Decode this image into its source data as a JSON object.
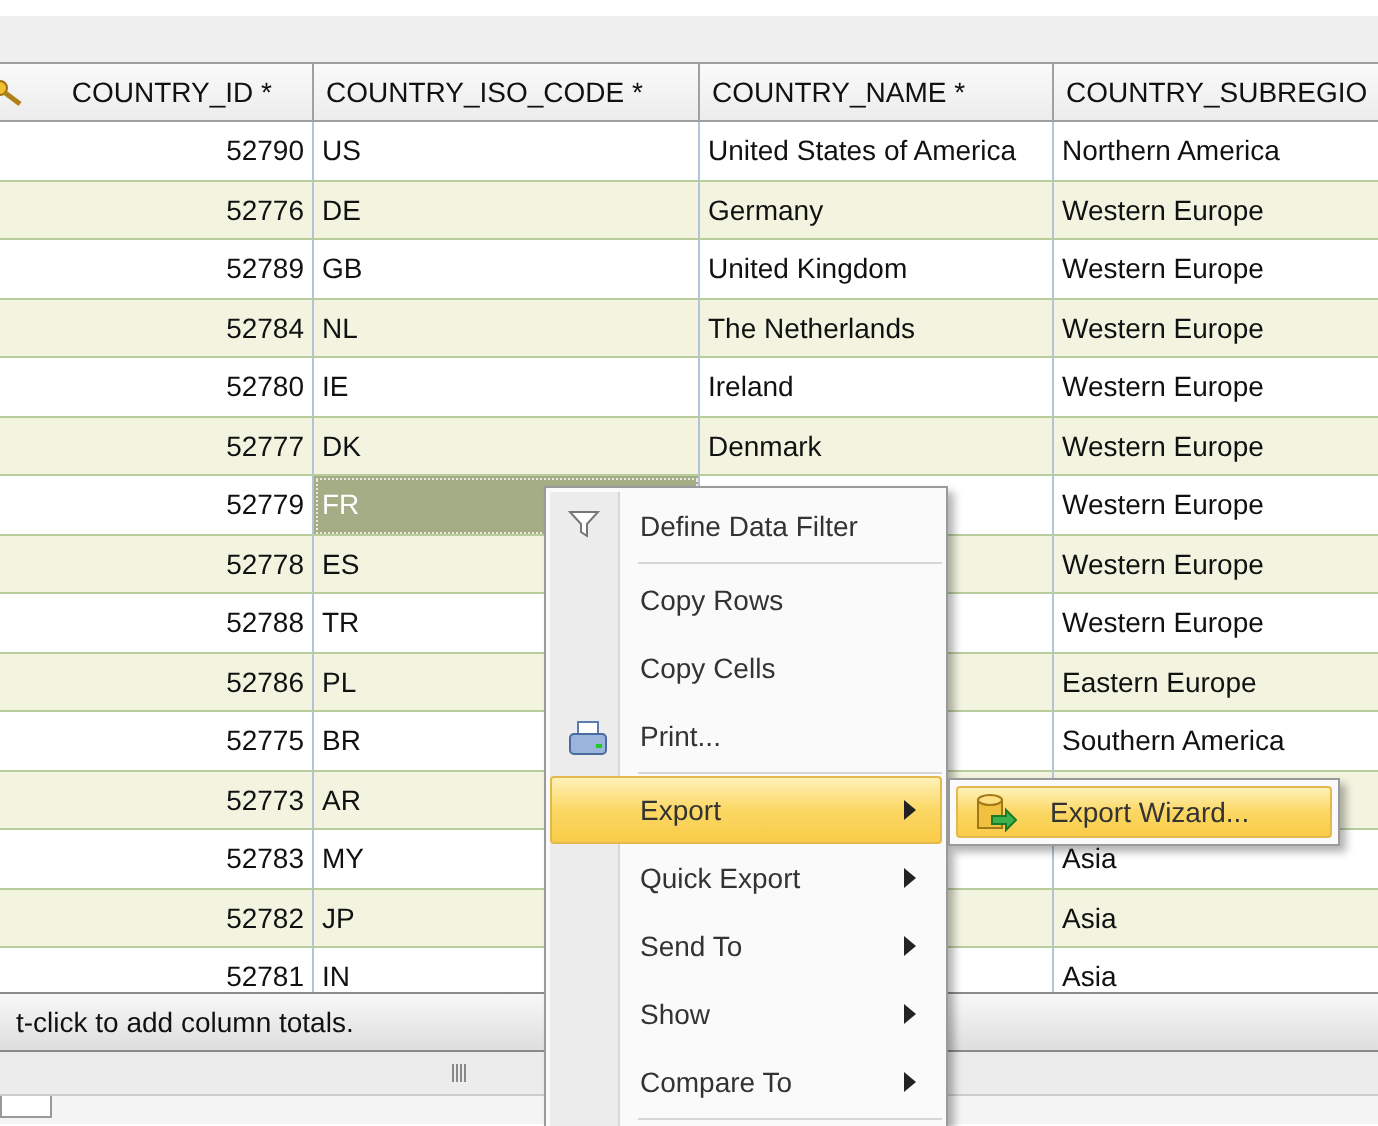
{
  "table": {
    "columns": [
      {
        "label": "COUNTRY_ID *",
        "key_icon": true
      },
      {
        "label": "COUNTRY_ISO_CODE *",
        "key_icon": false
      },
      {
        "label": "COUNTRY_NAME *",
        "key_icon": false
      },
      {
        "label": "COUNTRY_SUBREGIO",
        "key_icon": false
      }
    ],
    "rows": [
      {
        "id": "52790",
        "iso": "US",
        "name": "United States of America",
        "subregion": "Northern America",
        "selected": false
      },
      {
        "id": "52776",
        "iso": "DE",
        "name": "Germany",
        "subregion": "Western Europe",
        "selected": false
      },
      {
        "id": "52789",
        "iso": "GB",
        "name": "United Kingdom",
        "subregion": "Western Europe",
        "selected": false
      },
      {
        "id": "52784",
        "iso": "NL",
        "name": "The Netherlands",
        "subregion": "Western Europe",
        "selected": false
      },
      {
        "id": "52780",
        "iso": "IE",
        "name": "Ireland",
        "subregion": "Western Europe",
        "selected": false
      },
      {
        "id": "52777",
        "iso": "DK",
        "name": "Denmark",
        "subregion": "Western Europe",
        "selected": false
      },
      {
        "id": "52779",
        "iso": "FR",
        "subregion": "Western Europe",
        "selected": true
      },
      {
        "id": "52778",
        "iso": "ES",
        "subregion": "Western Europe",
        "selected": false
      },
      {
        "id": "52788",
        "iso": "TR",
        "subregion": "Western Europe",
        "selected": false
      },
      {
        "id": "52786",
        "iso": "PL",
        "subregion": "Eastern Europe",
        "selected": false
      },
      {
        "id": "52775",
        "iso": "BR",
        "subregion": "Southern America",
        "selected": false
      },
      {
        "id": "52773",
        "iso": "AR",
        "selected": false
      },
      {
        "id": "52783",
        "iso": "MY",
        "subregion": "Asia",
        "selected": false
      },
      {
        "id": "52782",
        "iso": "JP",
        "subregion": "Asia",
        "selected": false
      },
      {
        "id": "52781",
        "iso": "IN",
        "subregion": "Asia",
        "selected": false
      }
    ]
  },
  "status_bar": {
    "text": "t-click to add column totals."
  },
  "context_menu": {
    "items": [
      {
        "kind": "filter",
        "label": "Define Data Filter",
        "selected": false
      },
      {
        "kind": "separator"
      },
      {
        "kind": "plain",
        "label": "Copy Rows",
        "selected": false
      },
      {
        "kind": "plain",
        "label": "Copy Cells",
        "selected": false
      },
      {
        "kind": "printer",
        "label": "Print...",
        "selected": false
      },
      {
        "kind": "separator"
      },
      {
        "kind": "submenu",
        "label": "Export",
        "selected": true
      },
      {
        "kind": "submenu",
        "label": "Quick Export",
        "selected": false
      },
      {
        "kind": "submenu",
        "label": "Send To",
        "selected": false
      },
      {
        "kind": "submenu",
        "label": "Show",
        "selected": false
      },
      {
        "kind": "submenu",
        "label": "Compare To",
        "selected": false
      },
      {
        "kind": "separator"
      }
    ],
    "submenu": {
      "items": [
        {
          "kind": "database",
          "label": "Export Wizard...",
          "selected": true
        }
      ]
    }
  }
}
